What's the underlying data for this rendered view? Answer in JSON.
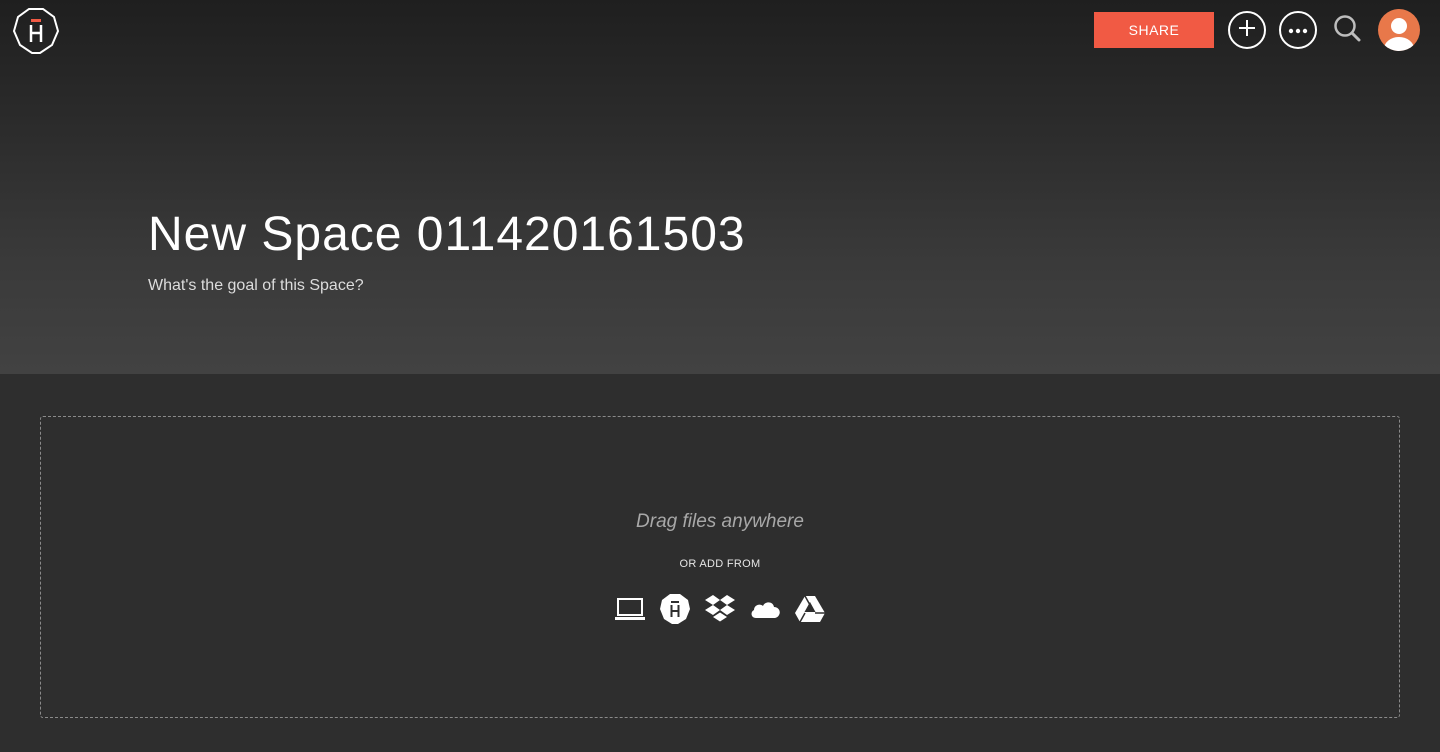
{
  "header": {
    "logo_icon": "hightail-logo-icon",
    "share_label": "SHARE",
    "add_icon": "plus-icon",
    "more_icon": "ellipsis-icon",
    "search_icon": "search-icon",
    "avatar_icon": "user-avatar-icon"
  },
  "space": {
    "title": "New Space 011420161503",
    "goal_placeholder": "What's the goal of this Space?"
  },
  "dropzone": {
    "drag_text": "Drag files anywhere",
    "or_add_from": "OR ADD FROM",
    "sources": [
      {
        "icon": "laptop-icon",
        "name": "computer"
      },
      {
        "icon": "hightail-icon",
        "name": "hightail"
      },
      {
        "icon": "dropbox-icon",
        "name": "dropbox"
      },
      {
        "icon": "onedrive-icon",
        "name": "onedrive"
      },
      {
        "icon": "google-drive-icon",
        "name": "google-drive"
      }
    ]
  },
  "colors": {
    "accent": "#f15a44",
    "avatar": "#e8784a",
    "background": "#2e2e2e"
  }
}
